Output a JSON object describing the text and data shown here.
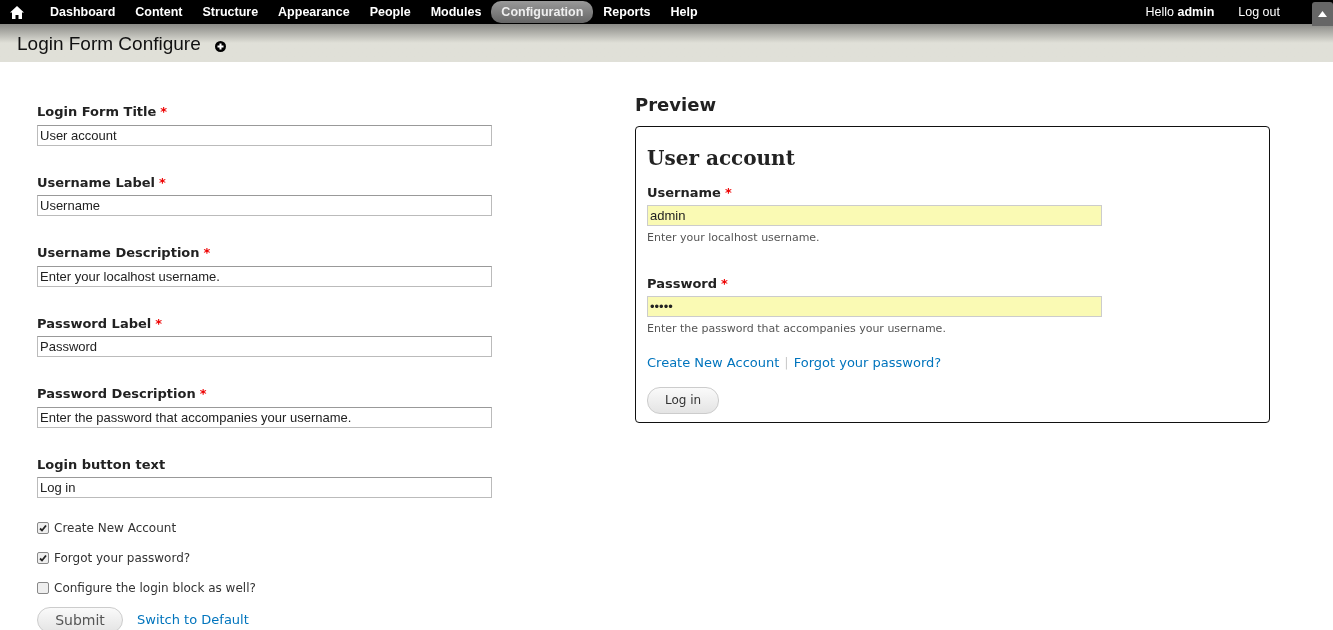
{
  "toolbar": {
    "menu": [
      {
        "label": "Dashboard",
        "selected": false
      },
      {
        "label": "Content",
        "selected": false
      },
      {
        "label": "Structure",
        "selected": false
      },
      {
        "label": "Appearance",
        "selected": false
      },
      {
        "label": "People",
        "selected": false
      },
      {
        "label": "Modules",
        "selected": false
      },
      {
        "label": "Configuration",
        "selected": true
      },
      {
        "label": "Reports",
        "selected": false
      },
      {
        "label": "Help",
        "selected": false
      }
    ],
    "greeting": "Hello **admin**",
    "logout": "Log out"
  },
  "page_title": "Login Form Configure",
  "form": {
    "fields": [
      {
        "label": "Login Form Title",
        "required_mark": "*",
        "value": "User account"
      },
      {
        "label": "Username Label",
        "required_mark": "*",
        "value": "Username"
      },
      {
        "label": "Username Description",
        "required_mark": "*",
        "value": "Enter your localhost username."
      },
      {
        "label": "Password Label",
        "required_mark": "*",
        "value": "Password"
      },
      {
        "label": "Password Description",
        "required_mark": "*",
        "value": "Enter the password that accompanies your username."
      },
      {
        "label": "Login button text",
        "value": "Log in"
      }
    ],
    "checkboxes": [
      {
        "label": "Create New Account",
        "checked": true
      },
      {
        "label": "Forgot your password?",
        "checked": true
      },
      {
        "label": "Configure the login block as well?",
        "checked": false
      }
    ],
    "submit": "Submit",
    "reset_link": "Switch to Default"
  },
  "preview": {
    "heading": "Preview",
    "title": "User account",
    "fields": [
      {
        "label": "Username",
        "required_mark": "*",
        "value": "admin",
        "description": "Enter your localhost username."
      },
      {
        "label": "Password",
        "required_mark": "*",
        "value": "•••••",
        "description": "Enter the password that accompanies your username."
      }
    ],
    "links": [
      "Create New Account",
      "Forgot your password?"
    ],
    "separator": "|",
    "button": "Log in"
  }
}
